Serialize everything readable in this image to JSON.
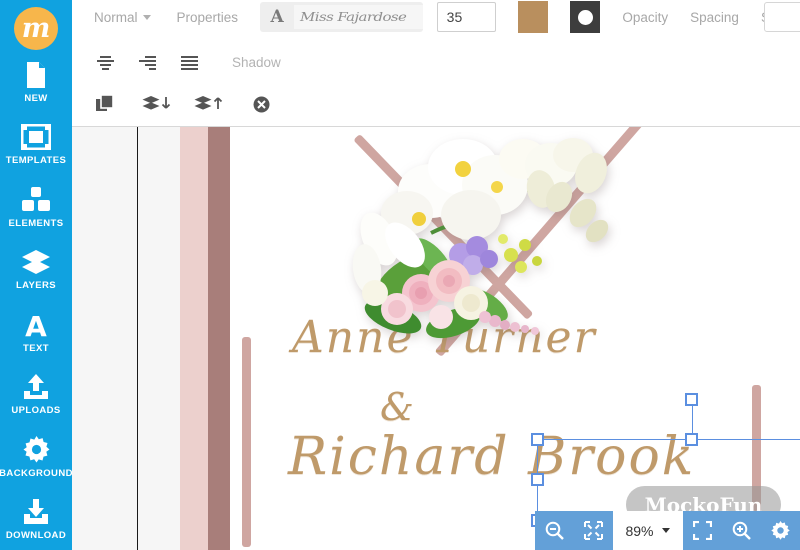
{
  "app": {
    "name": "MockoFun",
    "logo_letter": "m",
    "logo_color": "#f7b64b",
    "sidebar_color": "#10a2e0",
    "accent_color": "#63a0d8"
  },
  "sidebar": {
    "items": [
      {
        "label": "NEW",
        "icon": "new-document-icon"
      },
      {
        "label": "TEMPLATES",
        "icon": "templates-icon"
      },
      {
        "label": "ELEMENTS",
        "icon": "elements-icon"
      },
      {
        "label": "LAYERS",
        "icon": "layers-icon"
      },
      {
        "label": "TEXT",
        "icon": "text-icon"
      },
      {
        "label": "UPLOADS",
        "icon": "uploads-icon"
      },
      {
        "label": "BACKGROUND",
        "icon": "background-gear-icon"
      },
      {
        "label": "DOWNLOAD",
        "icon": "download-icon"
      }
    ]
  },
  "toolbar": {
    "blend_mode": "Normal",
    "properties_label": "Properties",
    "font_glyph": "A",
    "font_name": "Miss Fajardose",
    "font_size": "35",
    "fill_color": "#b98f5e",
    "shadow_color": "#3d3d3d",
    "opacity_label": "Opacity",
    "spacing_label": "Spacing",
    "stroke_label": "Stroke",
    "shadow_label": "Shadow",
    "align_icons": [
      "align-center-icon",
      "align-right-icon",
      "align-justify-icon"
    ],
    "arrange_icons": [
      "duplicate-icon",
      "send-backward-icon",
      "bring-forward-icon",
      "delete-icon"
    ]
  },
  "canvas": {
    "text_line_1": "Anne Turner",
    "text_ampersand": "&",
    "text_line_2": "Richard Brook",
    "text_color": "#bf9a6a",
    "card_background": "#ffffff",
    "stripe_light": "#ecd0cd",
    "stripe_dark": "#a87e7a",
    "flap_color": "#cfa6a1",
    "selection_color": "#5b8fe0"
  },
  "watermark": {
    "text": "MockoFun"
  },
  "zoombar": {
    "zoom_level": "89%",
    "buttons": [
      "zoom-out-icon",
      "fit-to-screen-icon",
      "zoom-level-dropdown",
      "fullscreen-icon",
      "zoom-in-icon",
      "settings-gear-icon"
    ]
  }
}
